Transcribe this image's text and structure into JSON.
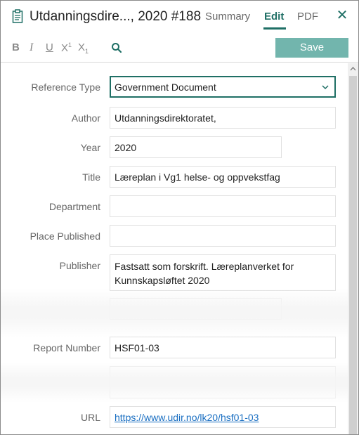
{
  "header": {
    "title": "Utdanningsdire..., 2020 #188",
    "tabs": {
      "summary": "Summary",
      "edit": "Edit",
      "pdf": "PDF"
    },
    "close": "✕"
  },
  "toolbar": {
    "bold": "B",
    "italic": "I",
    "underline": "U",
    "superscript_base": "X",
    "superscript_mark": "1",
    "subscript_base": "X",
    "subscript_mark": "1",
    "save_label": "Save"
  },
  "form": {
    "reference_type": {
      "label": "Reference Type",
      "value": "Government Document"
    },
    "author": {
      "label": "Author",
      "value": "Utdanningsdirektoratet,"
    },
    "year": {
      "label": "Year",
      "value": "2020"
    },
    "title": {
      "label": "Title",
      "value": "Læreplan i Vg1 helse- og oppvekstfag"
    },
    "department": {
      "label": "Department",
      "value": ""
    },
    "place_published": {
      "label": "Place Published",
      "value": ""
    },
    "publisher": {
      "label": "Publisher",
      "value": "Fastsatt som forskrift. Læreplanverket for Kunnskapsløftet 2020"
    },
    "report_number": {
      "label": "Report Number",
      "value": "HSF01-03"
    },
    "url": {
      "label": "URL",
      "value": "https://www.udir.no/lk20/hsf01-03"
    }
  },
  "colors": {
    "accent": "#1f6f65",
    "save_button": "#72b5ad",
    "link": "#1a6fc2"
  },
  "icons": {
    "reference": "clipboard-icon",
    "search": "search-icon",
    "close": "close-icon",
    "dropdown": "chevron-down-icon"
  }
}
